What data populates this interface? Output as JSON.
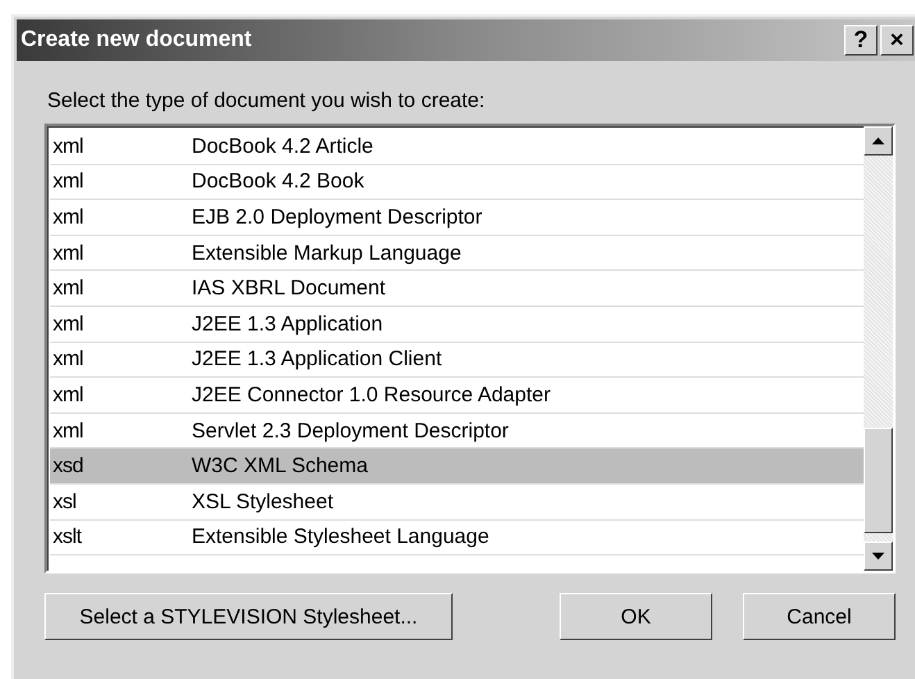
{
  "window": {
    "title": "Create new document",
    "help_button": "?",
    "close_button": "×"
  },
  "prompt": "Select the type of document you wish to create:",
  "rows": [
    {
      "extension": "xml",
      "description": "DocBook 4.2 Article",
      "selected": false
    },
    {
      "extension": "xml",
      "description": "DocBook 4.2 Book",
      "selected": false
    },
    {
      "extension": "xml",
      "description": "EJB 2.0 Deployment Descriptor",
      "selected": false
    },
    {
      "extension": "xml",
      "description": "Extensible Markup Language",
      "selected": false
    },
    {
      "extension": "xml",
      "description": "IAS XBRL Document",
      "selected": false
    },
    {
      "extension": "xml",
      "description": "J2EE 1.3 Application",
      "selected": false
    },
    {
      "extension": "xml",
      "description": "J2EE 1.3 Application Client",
      "selected": false
    },
    {
      "extension": "xml",
      "description": "J2EE Connector 1.0 Resource Adapter",
      "selected": false
    },
    {
      "extension": "xml",
      "description": "Servlet 2.3 Deployment Descriptor",
      "selected": false
    },
    {
      "extension": "xsd",
      "description": "W3C XML Schema",
      "selected": true
    },
    {
      "extension": "xsl",
      "description": "XSL Stylesheet",
      "selected": false
    },
    {
      "extension": "xslt",
      "description": "Extensible Stylesheet Language",
      "selected": false
    }
  ],
  "buttons": {
    "stylesheet": "Select a STYLEVISION Stylesheet...",
    "ok": "OK",
    "cancel": "Cancel"
  }
}
